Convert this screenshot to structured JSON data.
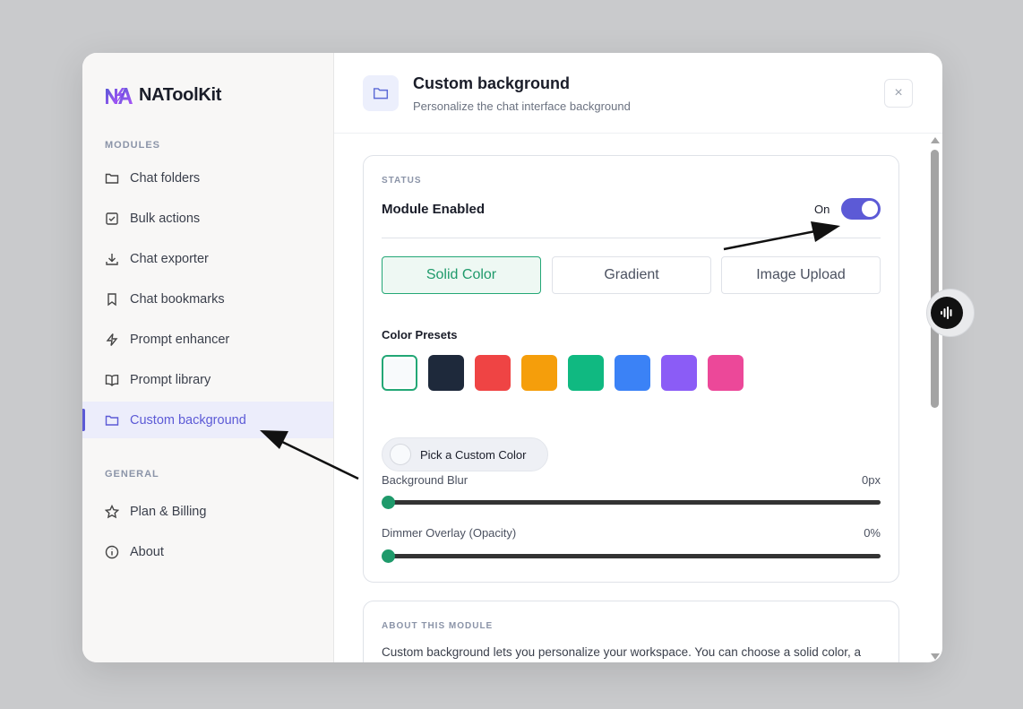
{
  "brand": {
    "name": "NAToolKit",
    "logo_icon": "na-logo-icon"
  },
  "sidebar": {
    "modules_title": "MODULES",
    "general_title": "GENERAL",
    "modules": [
      {
        "label": "Chat folders",
        "icon": "folder-icon"
      },
      {
        "label": "Bulk actions",
        "icon": "checkbox-icon"
      },
      {
        "label": "Chat exporter",
        "icon": "download-icon"
      },
      {
        "label": "Chat bookmarks",
        "icon": "bookmark-icon"
      },
      {
        "label": "Prompt enhancer",
        "icon": "lightning-icon"
      },
      {
        "label": "Prompt library",
        "icon": "book-icon"
      },
      {
        "label": "Custom background",
        "icon": "folder-icon",
        "active": true
      }
    ],
    "general": [
      {
        "label": "Plan & Billing",
        "icon": "star-icon"
      },
      {
        "label": "About",
        "icon": "info-icon"
      }
    ]
  },
  "header": {
    "title": "Custom background",
    "subtitle": "Personalize the chat interface background",
    "icon": "folder-icon",
    "close_label": "×"
  },
  "status_card": {
    "section_label": "STATUS",
    "module_title": "Module Enabled",
    "toggle_label": "On",
    "enabled": true,
    "tabs": [
      "Solid Color",
      "Gradient",
      "Image Upload"
    ],
    "active_tab": "Solid Color",
    "presets_label": "Color Presets",
    "presets": [
      "#f8fafc",
      "#1e293b",
      "#ef4444",
      "#f59e0b",
      "#10b981",
      "#3b82f6",
      "#8b5cf6",
      "#ec4899"
    ],
    "selected_preset": "#f8fafc",
    "custom_color_label": "Pick a Custom Color",
    "blur": {
      "label": "Background Blur",
      "value_text": "0px",
      "value": 0
    },
    "dimmer": {
      "label": "Dimmer Overlay (Opacity)",
      "value_text": "0%",
      "value": 0
    }
  },
  "about_card": {
    "section_label": "ABOUT THIS MODULE",
    "text": "Custom background lets you personalize your workspace. You can choose a solid color, a"
  },
  "colors": {
    "accent": "#5c5ad6",
    "success": "#1f9a6b"
  }
}
